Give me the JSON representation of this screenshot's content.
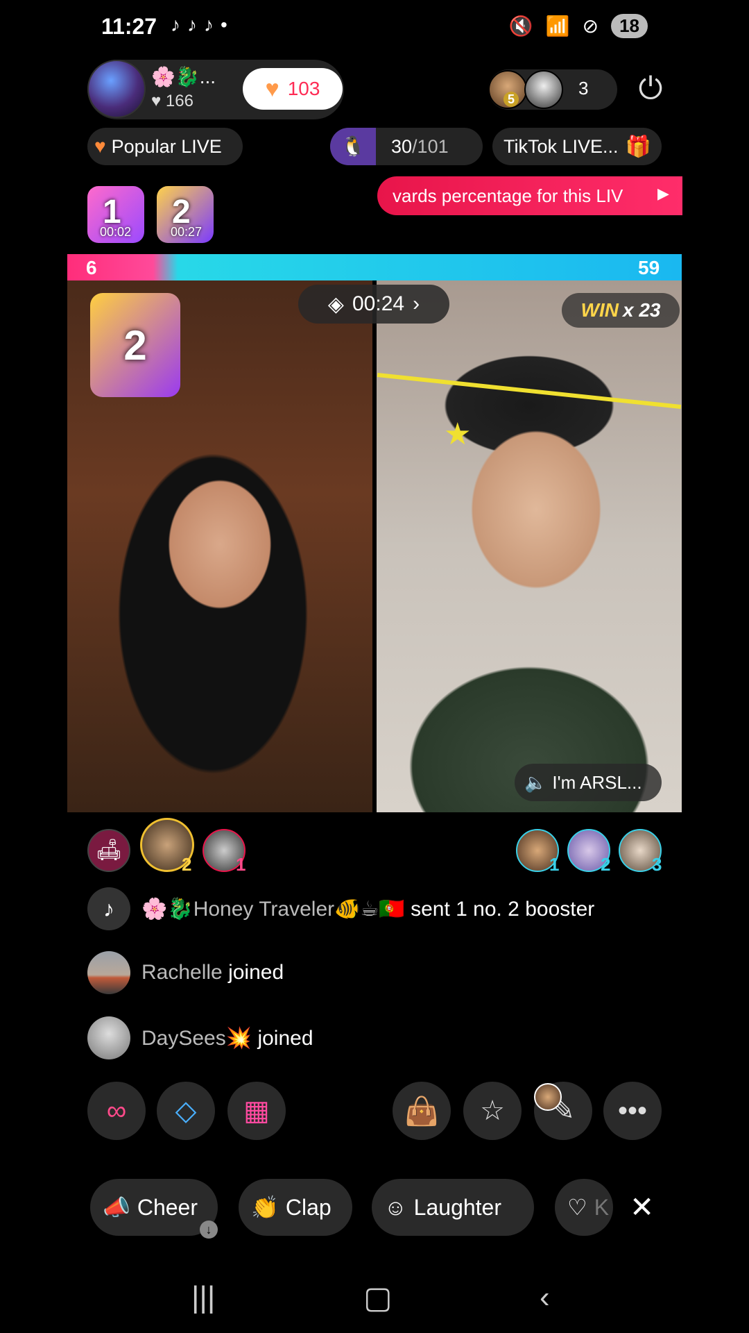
{
  "status_bar": {
    "time": "11:27",
    "left_icons": [
      "tiktok-icon",
      "tiktok-icon",
      "tiktok-icon"
    ],
    "dot": "•",
    "battery": "18"
  },
  "host": {
    "name": "🌸🐉...",
    "likes_count": "166",
    "like_button_count": "103"
  },
  "viewers": {
    "count": "3",
    "top_badge": "5"
  },
  "row2": {
    "popular_label": "Popular LIVE",
    "rank_current": "30",
    "rank_total": "/101",
    "tiktok_live_label": "TikTok LIVE..."
  },
  "badges": [
    {
      "label": "1",
      "time": "00:02"
    },
    {
      "label": "2",
      "time": "00:27"
    }
  ],
  "promo_banner": "vards percentage for this LIV",
  "battle": {
    "left_score": "6",
    "right_score": "59",
    "timer": "00:24",
    "win_label": "WIN",
    "win_count": "x 23",
    "right_audio_label": "I'm ARSL...",
    "booster_num": "2"
  },
  "supporters": {
    "left_ranks": [
      "2",
      "1"
    ],
    "right_ranks": [
      "1",
      "2",
      "3"
    ]
  },
  "chat": [
    {
      "name": "🌸🐉Honey Traveler🐠☕🇵🇹",
      "text": "sent 1 no. 2 booster"
    },
    {
      "name": "Rachelle",
      "text": "joined"
    },
    {
      "name": "DaySees💥",
      "text": "joined"
    }
  ],
  "reactions": {
    "cheer": "Cheer",
    "clap": "Clap",
    "laughter": "Laughter",
    "partial": "K"
  }
}
